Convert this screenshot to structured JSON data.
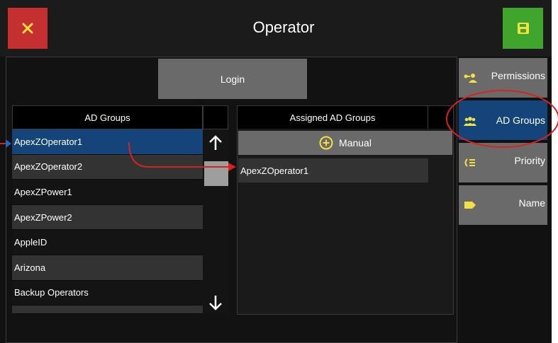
{
  "window": {
    "title": "Operator"
  },
  "header": {
    "close_icon": "close-icon",
    "save_icon": "save-icon",
    "close_color": "#c62f2f",
    "save_color": "#3fa52d"
  },
  "main": {
    "login_label": "Login",
    "ad_groups": {
      "header": "AD Groups",
      "items": [
        {
          "label": "ApexZOperator1",
          "selected": true
        },
        {
          "label": "ApexZOperator2"
        },
        {
          "label": "ApexZPower1"
        },
        {
          "label": "ApexZPower2"
        },
        {
          "label": "AppleID"
        },
        {
          "label": "Arizona"
        },
        {
          "label": "Backup Operators"
        }
      ]
    },
    "assigned": {
      "header": "Assigned AD Groups",
      "manual_label": "Manual",
      "items": [
        "ApexZOperator1"
      ]
    }
  },
  "nav": {
    "items": [
      {
        "label": "Permissions",
        "icon": "permissions-icon"
      },
      {
        "label": "AD Groups",
        "icon": "groups-icon",
        "active": true
      },
      {
        "label": "Priority",
        "icon": "priority-icon"
      },
      {
        "label": "Name",
        "icon": "tag-icon"
      }
    ]
  },
  "colors": {
    "accent": "#14447a",
    "icon_yellow": "#f5e042",
    "annotation_red": "#d9221e"
  }
}
